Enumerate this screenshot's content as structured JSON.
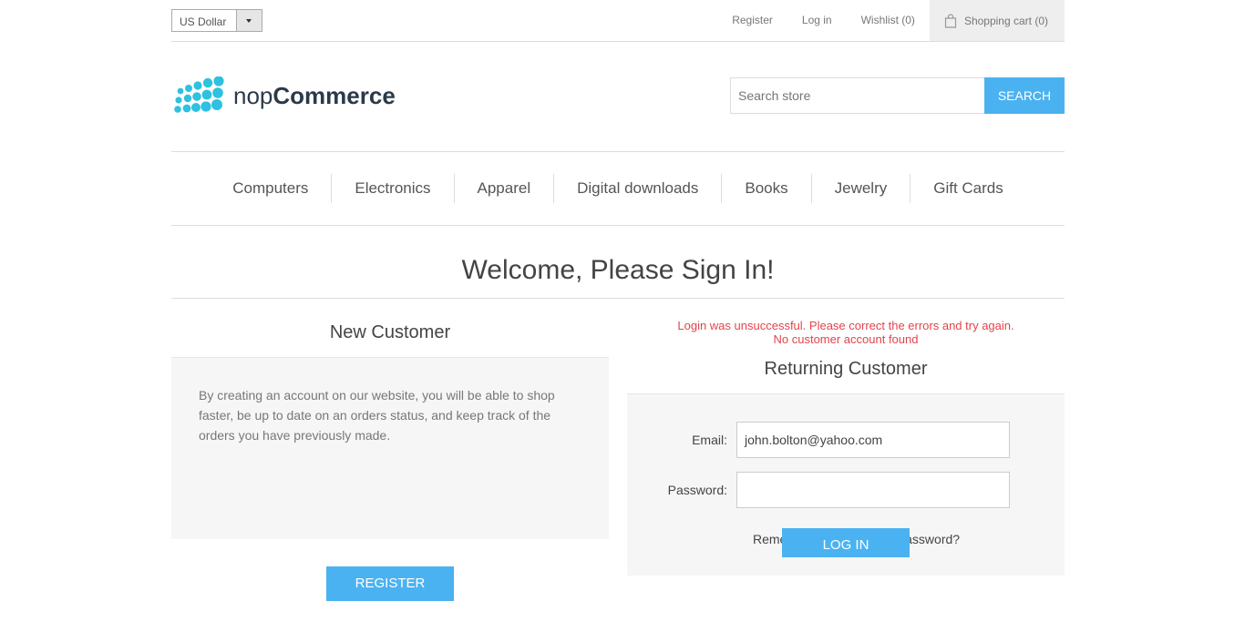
{
  "header": {
    "currency": "US Dollar",
    "links": {
      "register": "Register",
      "login": "Log in",
      "wishlist": "Wishlist (0)",
      "cart": "Shopping cart (0)"
    }
  },
  "logo": {
    "text_light": "nop",
    "text_bold": "Commerce"
  },
  "search": {
    "placeholder": "Search store",
    "button": "SEARCH"
  },
  "menu": [
    "Computers",
    "Electronics",
    "Apparel",
    "Digital downloads",
    "Books",
    "Jewelry",
    "Gift Cards"
  ],
  "page": {
    "title": "Welcome, Please Sign In!"
  },
  "new_customer": {
    "title": "New Customer",
    "text": "By creating an account on our website, you will be able to shop faster, be up to date on an orders status, and keep track of the orders you have previously made.",
    "register_button": "REGISTER"
  },
  "returning_customer": {
    "error_line1": "Login was unsuccessful. Please correct the errors and try again.",
    "error_line2": "No customer account found",
    "title": "Returning Customer",
    "email_label": "Email:",
    "email_value": "john.bolton@yahoo.com",
    "password_label": "Password:",
    "password_value": "",
    "remember_me": "Remember me?",
    "forgot_password": "Forgot password?",
    "login_button": "LOG IN"
  },
  "colors": {
    "accent": "#4ab2f1",
    "error": "#e4434b",
    "logo_dots": "#2ec1e0"
  }
}
